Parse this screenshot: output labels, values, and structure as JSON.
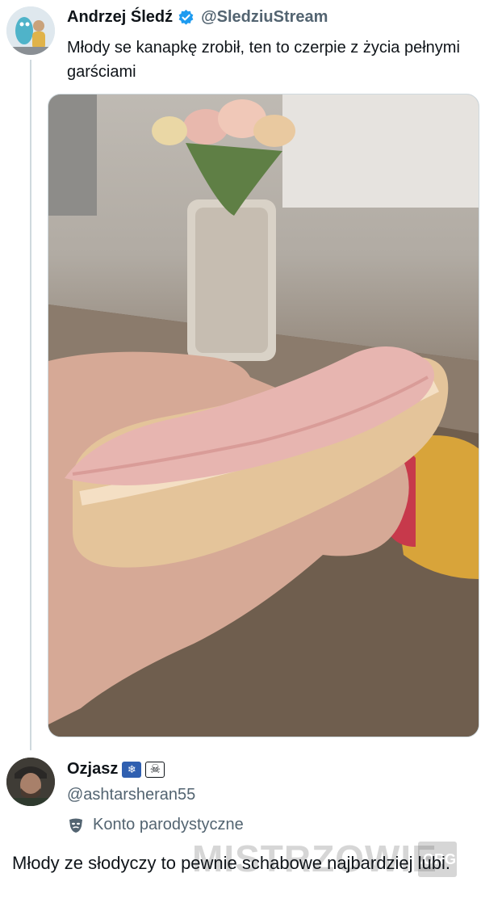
{
  "tweet": {
    "author_name": "Andrzej Śledź",
    "handle": "@SledziuStream",
    "text": "Młody se kanapkę zrobił, ten to czerpie z życia pełnymi garściami"
  },
  "reply": {
    "author_name": "Ozjasz",
    "handle": "@ashtarsheran55",
    "parody_label": "Konto parodystyczne",
    "badges": [
      "antarctica-flag-icon",
      "skull-crossbones-icon"
    ],
    "text": "Młody ze słodyczy to pewnie schabowe najbardziej lubi."
  },
  "watermark": {
    "text": "MISTRZOWIE",
    "suffix": ".ORG"
  },
  "colors": {
    "verified": "#1d9bf0",
    "secondary_text": "#536471",
    "thread_line": "#cfd9de"
  }
}
